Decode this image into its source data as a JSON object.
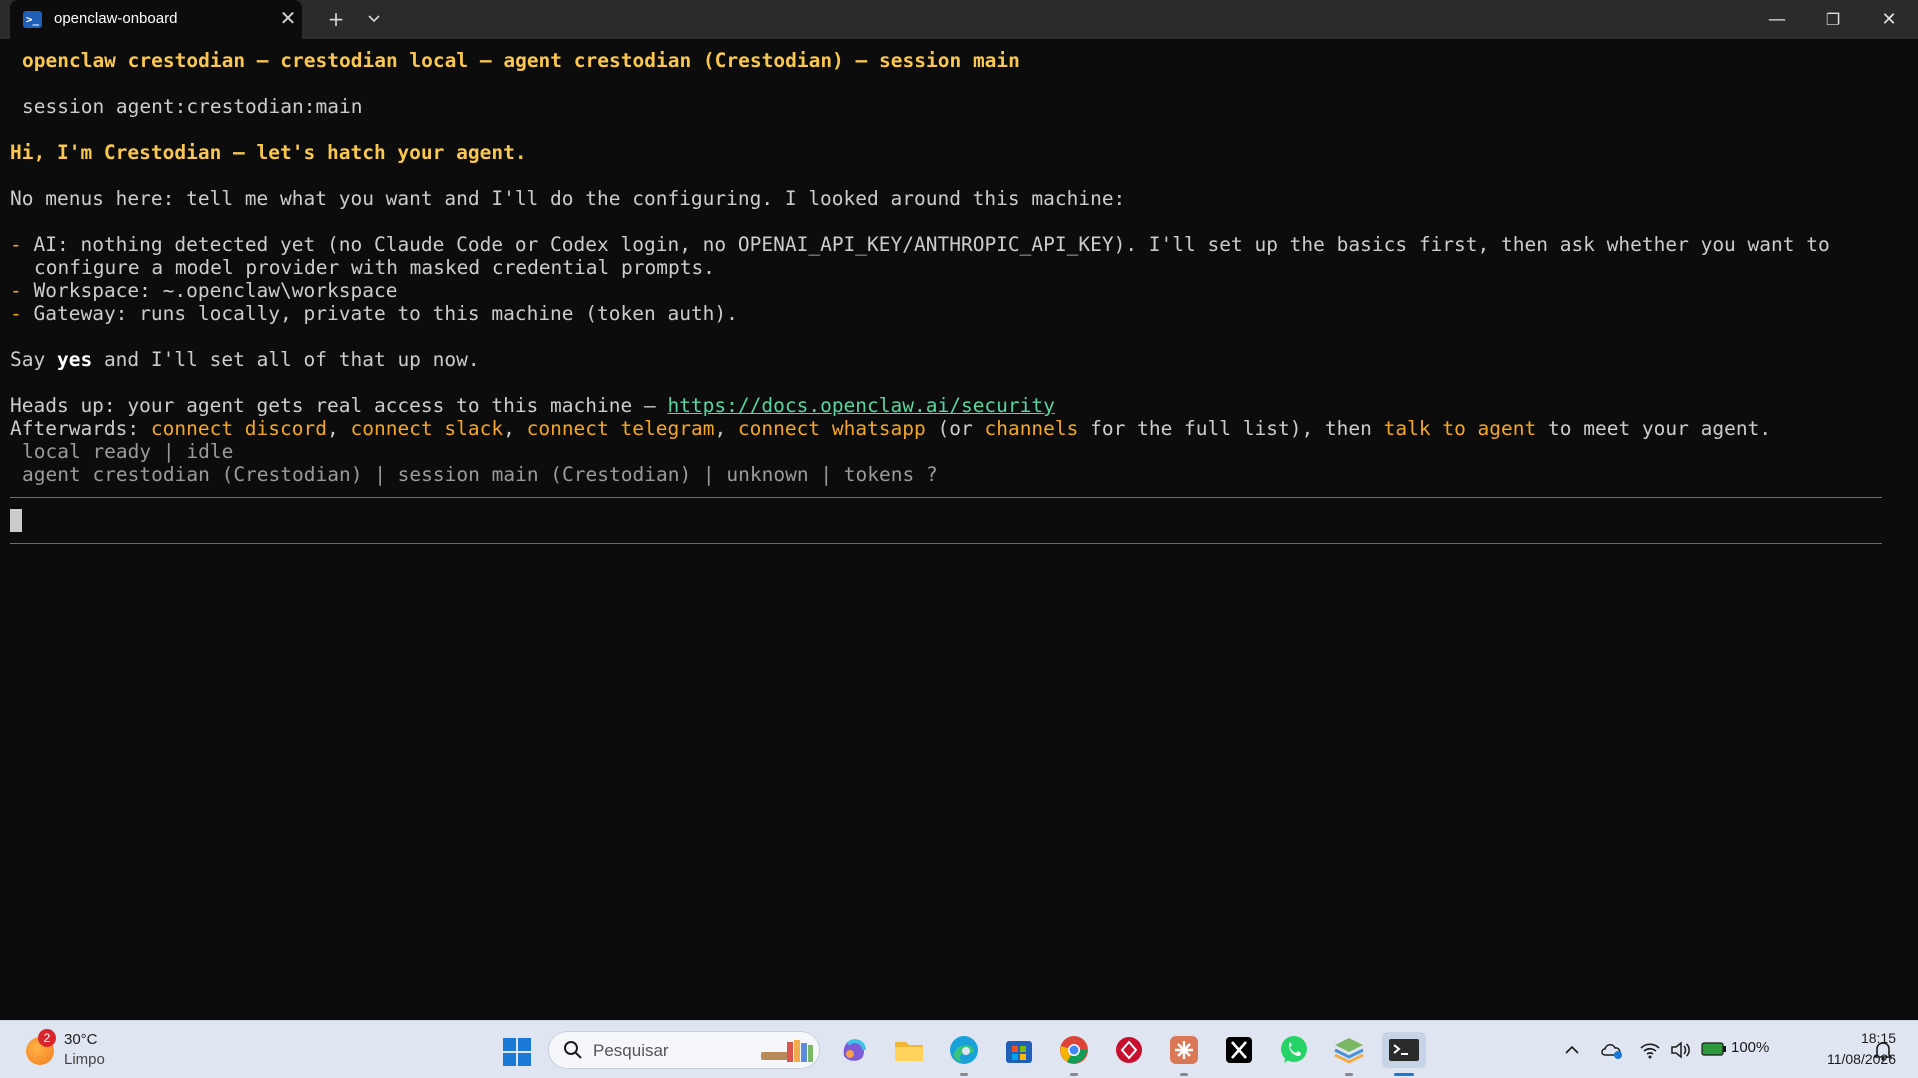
{
  "window": {
    "tab_title": "openclaw-onboard",
    "tab_icon": "powershell-icon",
    "new_tab_label": "+",
    "dropdown_label": "⌄",
    "minimize_label": "—",
    "maximize_label": "❐",
    "close_label": "✕"
  },
  "terminal": {
    "header": "openclaw crestodian – crestodian local – agent crestodian (Crestodian) – session main",
    "session_line": "session agent:crestodian:main",
    "greeting": "Hi, I'm Crestodian – let's hatch your agent.",
    "intro": "No menus here: tell me what you want and I'll do the configuring. I looked around this machine:",
    "bullet_marker": "-",
    "bullets": [
      "AI: nothing detected yet (no Claude Code or Codex login, no OPENAI_API_KEY/ANTHROPIC_API_KEY). I'll set up the basics first, then ask whether you want to",
      "configure a model provider with masked credential prompts.",
      "Workspace: ~.openclaw\\workspace",
      "Gateway: runs locally, private to this machine (token auth)."
    ],
    "say_prefix": "Say ",
    "say_word": "yes",
    "say_suffix": " and I'll set all of that up now.",
    "headsup_prefix": "Heads up: your agent gets real access to this machine – ",
    "headsup_link": "https://docs.openclaw.ai/security",
    "after_prefix": "Afterwards: ",
    "after_items": [
      "connect discord",
      "connect slack",
      "connect telegram",
      "connect whatsapp"
    ],
    "after_sep": ", ",
    "after_or": " (or ",
    "after_channels": "channels",
    "after_full": " for the full list), then ",
    "after_talk": "talk to agent",
    "after_end": " to meet your agent.",
    "status1": "local ready | idle",
    "status2": "agent crestodian (Crestodian) | session main (Crestodian) | unknown | tokens ?"
  },
  "taskbar": {
    "weather_badge": "2",
    "weather_temp": "30°C",
    "weather_cond": "Limpo",
    "search_placeholder": "Pesquisar",
    "apps": [
      "copilot-icon",
      "file-explorer-icon",
      "edge-icon",
      "store-icon",
      "chrome-icon",
      "app-red-icon",
      "claude-icon",
      "x-icon",
      "whatsapp-icon",
      "layers-icon",
      "terminal-icon"
    ],
    "battery": "100%",
    "time": "18:15",
    "date": "11/08/2026",
    "colors": {
      "taskbar_bg": "#dfe6f1",
      "accent": "#1a78d6"
    }
  }
}
